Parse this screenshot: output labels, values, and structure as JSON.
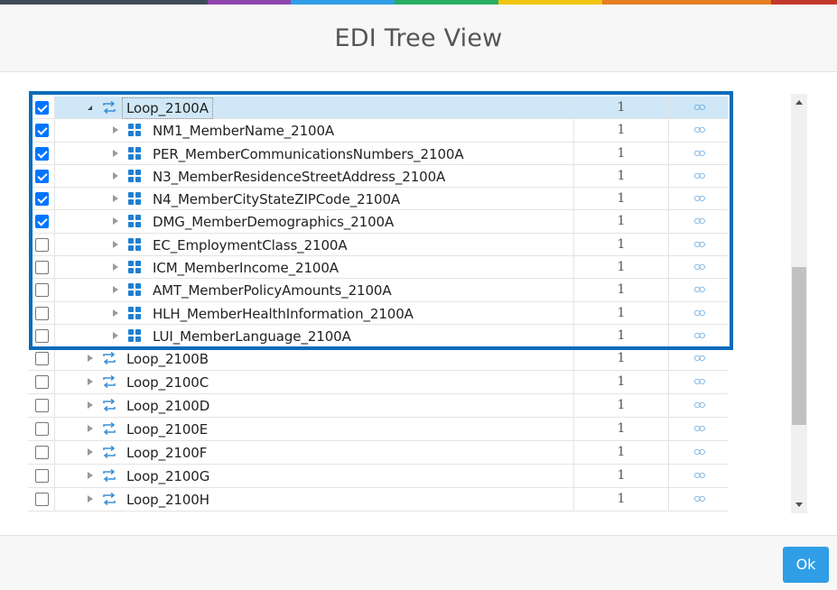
{
  "accent_colors": [
    "#3e4a5a",
    "#8e44ad",
    "#2f9ee6",
    "#27ae60",
    "#f1c40f",
    "#e67e22",
    "#c0392b"
  ],
  "dialog": {
    "title": "EDI Tree View",
    "ok_label": "Ok"
  },
  "rows": [
    {
      "label": "Loop_2100A",
      "count": "1",
      "checked": true,
      "type": "loop",
      "expanded": true,
      "selected": true
    },
    {
      "label": "NM1_MemberName_2100A",
      "count": "1",
      "checked": true,
      "type": "segment"
    },
    {
      "label": "PER_MemberCommunicationsNumbers_2100A",
      "count": "1",
      "checked": true,
      "type": "segment"
    },
    {
      "label": "N3_MemberResidenceStreetAddress_2100A",
      "count": "1",
      "checked": true,
      "type": "segment"
    },
    {
      "label": "N4_MemberCityStateZIPCode_2100A",
      "count": "1",
      "checked": true,
      "type": "segment"
    },
    {
      "label": "DMG_MemberDemographics_2100A",
      "count": "1",
      "checked": true,
      "type": "segment"
    },
    {
      "label": "EC_EmploymentClass_2100A",
      "count": "1",
      "checked": false,
      "type": "segment"
    },
    {
      "label": "ICM_MemberIncome_2100A",
      "count": "1",
      "checked": false,
      "type": "segment"
    },
    {
      "label": "AMT_MemberPolicyAmounts_2100A",
      "count": "1",
      "checked": false,
      "type": "segment"
    },
    {
      "label": "HLH_MemberHealthInformation_2100A",
      "count": "1",
      "checked": false,
      "type": "segment"
    },
    {
      "label": "LUI_MemberLanguage_2100A",
      "count": "1",
      "checked": false,
      "type": "segment"
    },
    {
      "label": "Loop_2100B",
      "count": "1",
      "checked": false,
      "type": "loop"
    },
    {
      "label": "Loop_2100C",
      "count": "1",
      "checked": false,
      "type": "loop"
    },
    {
      "label": "Loop_2100D",
      "count": "1",
      "checked": false,
      "type": "loop"
    },
    {
      "label": "Loop_2100E",
      "count": "1",
      "checked": false,
      "type": "loop"
    },
    {
      "label": "Loop_2100F",
      "count": "1",
      "checked": false,
      "type": "loop"
    },
    {
      "label": "Loop_2100G",
      "count": "1",
      "checked": false,
      "type": "loop"
    },
    {
      "label": "Loop_2100H",
      "count": "1",
      "checked": false,
      "type": "loop"
    }
  ],
  "icons": {
    "loop": "loop-arrows-icon",
    "segment": "segment-grid-icon",
    "link": "infinity-link-icon"
  }
}
